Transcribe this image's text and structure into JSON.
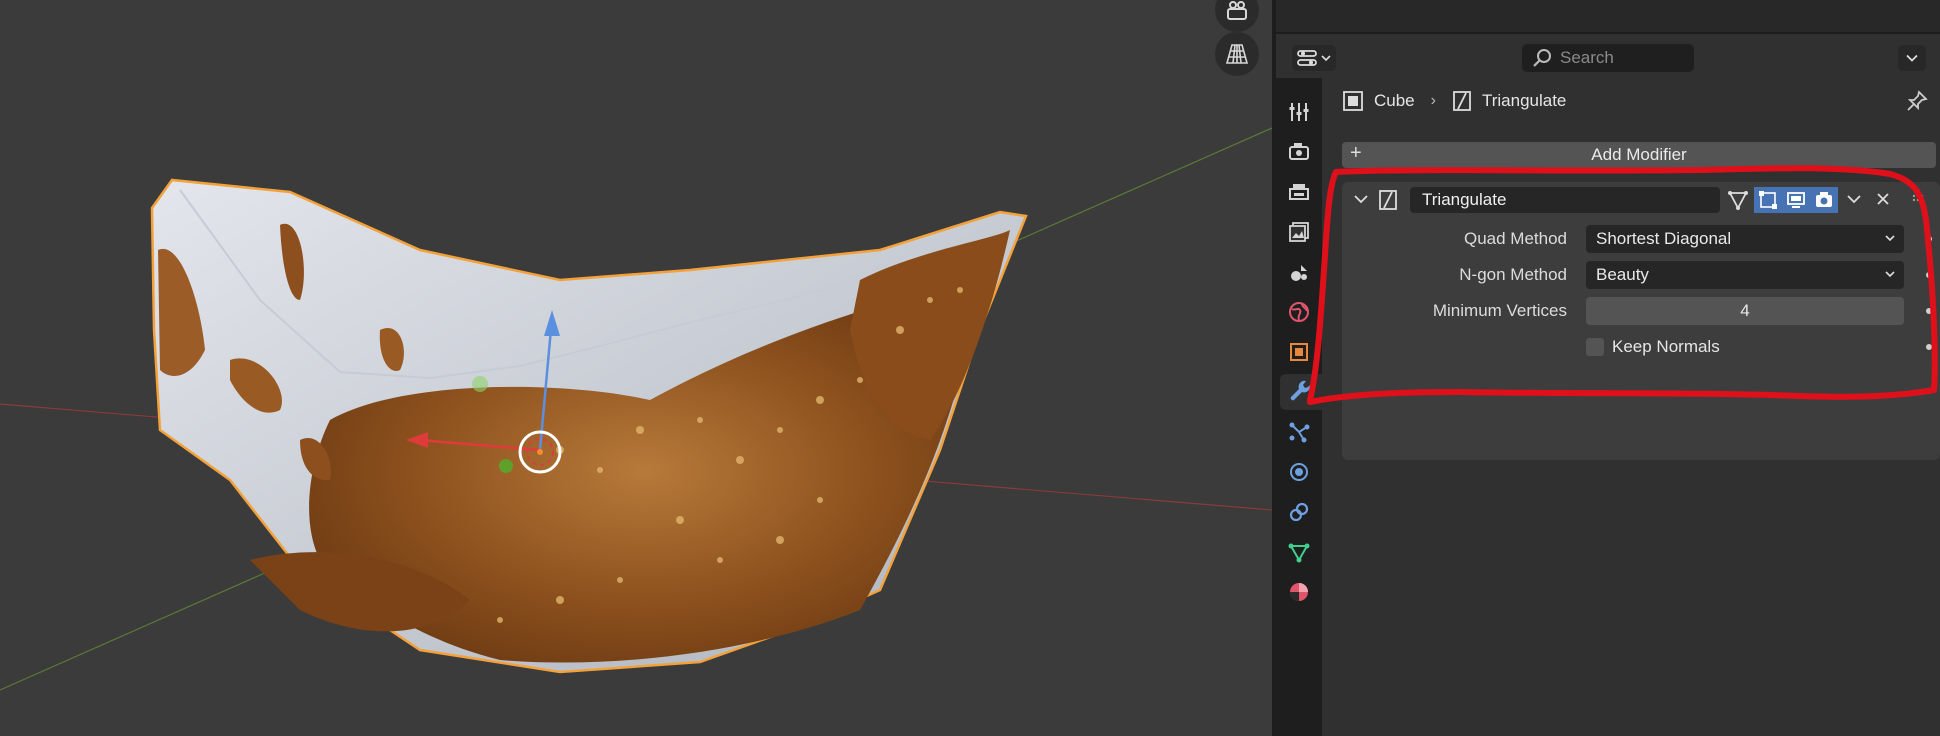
{
  "header": {
    "search_placeholder": "Search"
  },
  "breadcrumb": {
    "object": "Cube",
    "modifier": "Triangulate"
  },
  "modifiers": {
    "add_label": "Add Modifier",
    "triangulate": {
      "name": "Triangulate",
      "quad_method_label": "Quad Method",
      "quad_method_value": "Shortest Diagonal",
      "ngon_method_label": "N-gon Method",
      "ngon_method_value": "Beauty",
      "min_vertices_label": "Minimum Vertices",
      "min_vertices_value": "4",
      "keep_normals_label": "Keep Normals",
      "keep_normals_checked": false
    }
  },
  "tabs": [
    {
      "name": "tool-icon",
      "color": "#d4d4d4"
    },
    {
      "name": "render-icon",
      "color": "#d4d4d4"
    },
    {
      "name": "output-icon",
      "color": "#d4d4d4"
    },
    {
      "name": "view-layer-icon",
      "color": "#d4d4d4"
    },
    {
      "name": "scene-icon",
      "color": "#d4d4d4"
    },
    {
      "name": "world-icon",
      "color": "#e0556b"
    },
    {
      "name": "object-icon",
      "color": "#e8883a"
    },
    {
      "name": "modifier-wrench-icon",
      "color": "#6e9fe0",
      "active": true
    },
    {
      "name": "particles-icon",
      "color": "#6e9fe0"
    },
    {
      "name": "physics-icon",
      "color": "#6e9fe0"
    },
    {
      "name": "constraints-icon",
      "color": "#6e9fe0"
    },
    {
      "name": "data-icon",
      "color": "#3fcf8e"
    },
    {
      "name": "material-icon",
      "color": "#e0556b"
    }
  ],
  "colors": {
    "accent": "#4772b3",
    "annotation": "#e0101a",
    "selection_outline": "#f5a030"
  }
}
